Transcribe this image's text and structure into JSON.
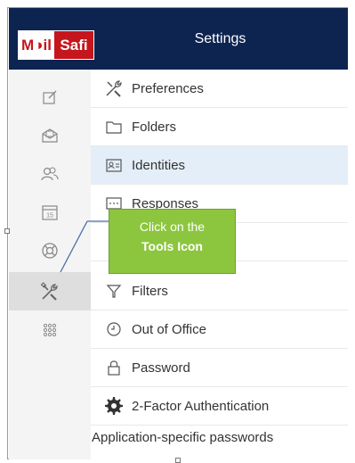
{
  "header": {
    "logo_mail": "M◑il",
    "logo_safi": "Safi",
    "title": "Settings"
  },
  "sidebar": {
    "items": [
      {
        "icon": "compose-icon"
      },
      {
        "icon": "mail-envelope-icon"
      },
      {
        "icon": "contacts-icon"
      },
      {
        "icon": "calendar-icon",
        "label": "15"
      },
      {
        "icon": "help-lifebuoy-icon"
      },
      {
        "icon": "tools-icon",
        "active": true
      },
      {
        "icon": "apps-grid-icon"
      }
    ]
  },
  "settings": {
    "items": [
      {
        "label": "Preferences",
        "icon": "tools-icon"
      },
      {
        "label": "Folders",
        "icon": "folder-icon"
      },
      {
        "label": "Identities",
        "icon": "id-card-icon",
        "active": true
      },
      {
        "label": "Responses",
        "icon": "response-icon"
      },
      {
        "label": "",
        "icon": ""
      },
      {
        "label": "Filters",
        "icon": "filter-icon"
      },
      {
        "label": "Out of Office",
        "icon": "clock-icon"
      },
      {
        "label": "Password",
        "icon": "lock-icon"
      },
      {
        "label": "2-Factor Authentication",
        "icon": "gear-icon"
      }
    ],
    "app_passwords": "Application-specific passwords"
  },
  "callout": {
    "line1": "Click on the",
    "line2": "Tools Icon"
  },
  "colors": {
    "header_bg": "#0d2451",
    "logo_red": "#c4161c",
    "callout_green": "#8cc63f",
    "active_row": "#e4eef8"
  }
}
